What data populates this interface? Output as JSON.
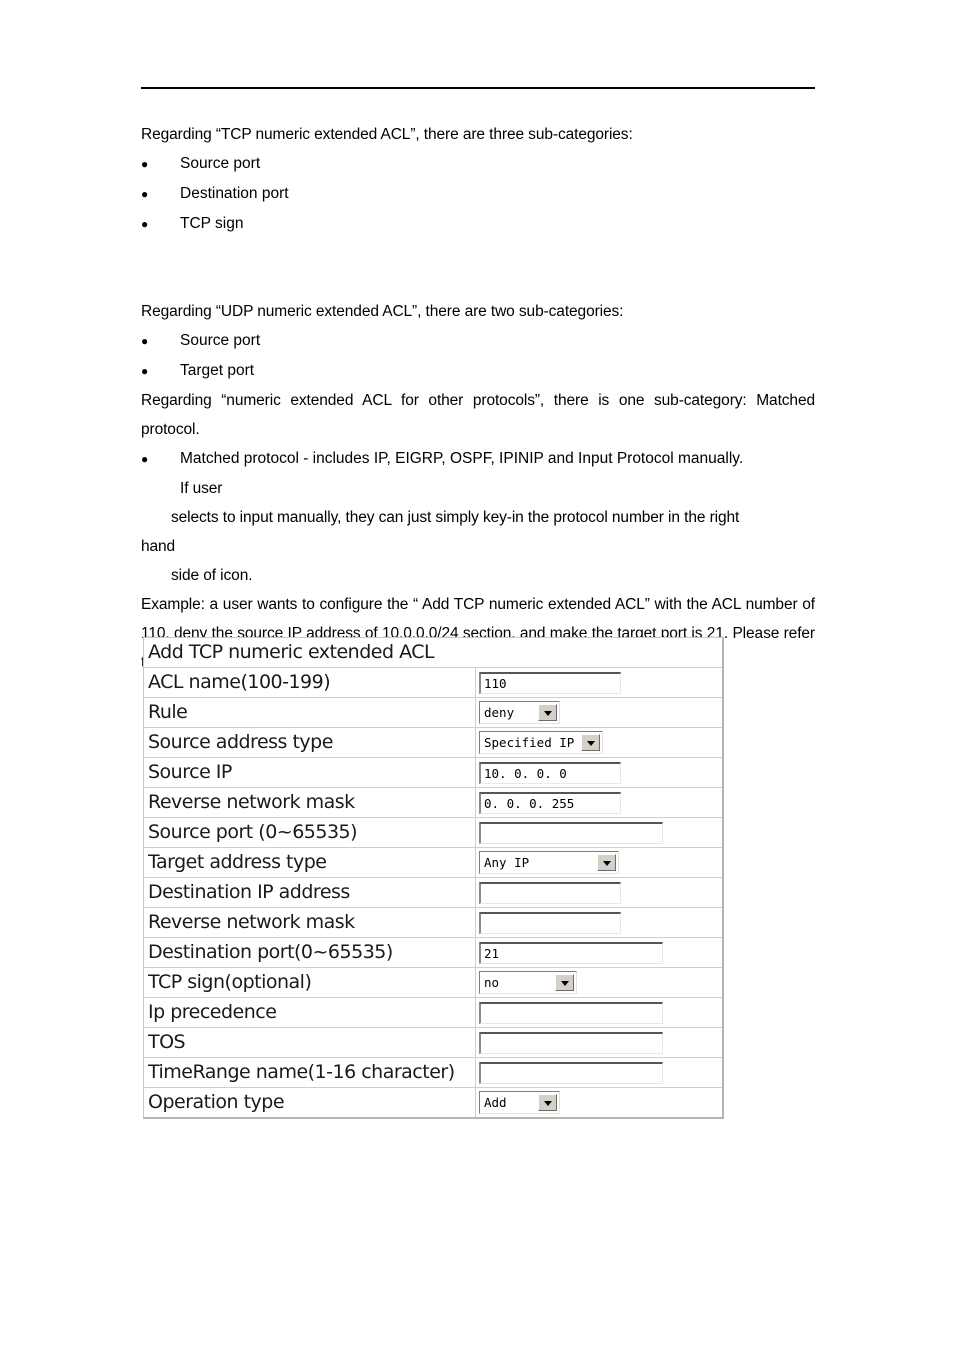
{
  "document": {
    "paragraphs": {
      "tcp_intro": "Regarding “TCP numeric extended ACL”, there are three sub-categories:",
      "udp_intro": "Regarding “UDP numeric extended ACL”, there are two sub-categories:",
      "other_intro": "Regarding “numeric extended ACL for other protocols”, there is one sub-category: Matched protocol.",
      "matched_protocol_bullet": "Matched protocol - includes IP, EIGRP, OSPF, IPINIP and Input Protocol manually.",
      "matched_protocol_line2": "If user",
      "matched_protocol_line3": "selects to input manually, they can just simply key-in the protocol number in the right",
      "matched_protocol_line4": "hand",
      "matched_protocol_line5": "side of icon.",
      "example": "Example: a user wants to configure the “ Add TCP numeric extended ACL” with the ACL number of 110, deny the source IP address of 10.0.0.0/24 section, and make the target port is 21. Please refer the following configurations and then click the icon of “Add”."
    },
    "tcp_bullets": [
      "Source port",
      "Destination port",
      "TCP sign"
    ],
    "udp_bullets": [
      "Source port",
      "Target port"
    ]
  },
  "form": {
    "title": "Add TCP numeric extended ACL",
    "rows": [
      {
        "label": "ACL name(100-199)",
        "control": "input",
        "value": "110",
        "size": "narrow"
      },
      {
        "label": "Rule",
        "control": "select",
        "value": "deny",
        "size": "s-sm"
      },
      {
        "label": "Source address type",
        "control": "select",
        "value": "Specified IP",
        "size": "s-lg"
      },
      {
        "label": "Source IP",
        "control": "input",
        "value": "10. 0. 0. 0",
        "size": "narrow"
      },
      {
        "label": "Reverse network mask",
        "control": "input",
        "value": "0. 0. 0. 255",
        "size": "narrow"
      },
      {
        "label": "Source port (0~65535)",
        "control": "input",
        "value": "",
        "size": "wide"
      },
      {
        "label": "Target address type",
        "control": "select",
        "value": "Any IP",
        "size": "s-xl"
      },
      {
        "label": "Destination IP address",
        "control": "input",
        "value": "",
        "size": "narrow"
      },
      {
        "label": "Reverse network mask",
        "control": "input",
        "value": "",
        "size": "narrow"
      },
      {
        "label": "Destination port(0~65535)",
        "control": "input",
        "value": "21",
        "size": "wide"
      },
      {
        "label": "TCP sign(optional)",
        "control": "select",
        "value": "no",
        "size": "s-md"
      },
      {
        "label": "Ip precedence",
        "control": "input",
        "value": "",
        "size": "wide"
      },
      {
        "label": "TOS",
        "control": "input",
        "value": "",
        "size": "wide"
      },
      {
        "label": "TimeRange name(1-16 character)",
        "control": "input",
        "value": "",
        "size": "wide"
      },
      {
        "label": "Operation type",
        "control": "select",
        "value": "Add",
        "size": "s-sm"
      }
    ]
  }
}
